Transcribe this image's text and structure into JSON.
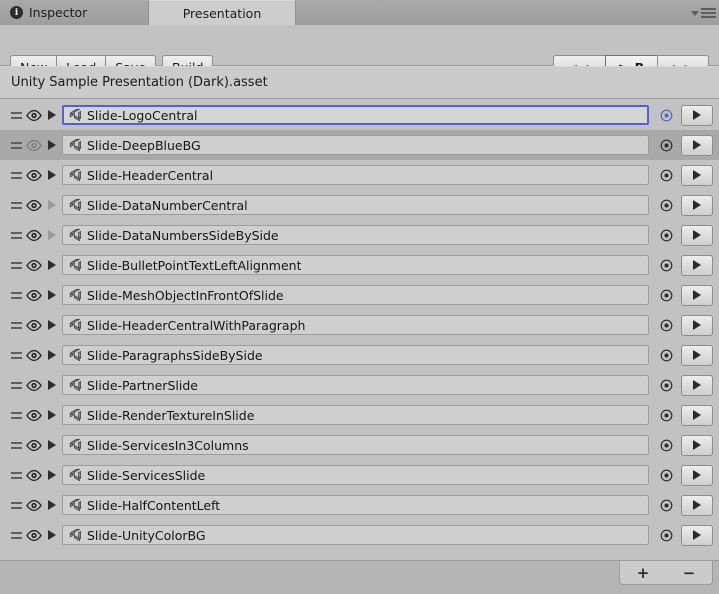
{
  "window": {
    "tabs": [
      {
        "label": "Inspector",
        "icon": "info-icon",
        "active": false
      },
      {
        "label": "Presentation",
        "icon": "",
        "active": true
      }
    ],
    "menu_icon": "hamburger-menu-icon"
  },
  "toolbar": {
    "new_label": "New",
    "load_label": "Load",
    "save_label": "Save",
    "build_label": "Build",
    "nav_prev_label": "<<",
    "nav_current_label": "> B",
    "nav_next_label": ">>"
  },
  "asset": {
    "name": "Unity Sample Presentation (Dark).asset"
  },
  "footer": {
    "add_label": "+",
    "remove_label": "−"
  },
  "colors": {
    "selection_outline": "#4f63d2",
    "panel_bg": "#c2c2c2",
    "row_alt_bg": "#a9a9a9",
    "field_bg": "#cfcfcf"
  },
  "slides": [
    {
      "name": "Slide-LogoCentral",
      "selected": true,
      "visible": true,
      "expandable": true
    },
    {
      "name": "Slide-DeepBlueBG",
      "selected": false,
      "visible": false,
      "expandable": true
    },
    {
      "name": "Slide-HeaderCentral",
      "selected": false,
      "visible": true,
      "expandable": true
    },
    {
      "name": "Slide-DataNumberCentral",
      "selected": false,
      "visible": true,
      "expandable": false
    },
    {
      "name": "Slide-DataNumbersSideBySide",
      "selected": false,
      "visible": true,
      "expandable": false
    },
    {
      "name": "Slide-BulletPointTextLeftAlignment",
      "selected": false,
      "visible": true,
      "expandable": true
    },
    {
      "name": "Slide-MeshObjectInFrontOfSlide",
      "selected": false,
      "visible": true,
      "expandable": true
    },
    {
      "name": "Slide-HeaderCentralWithParagraph",
      "selected": false,
      "visible": true,
      "expandable": true
    },
    {
      "name": "Slide-ParagraphsSideBySide",
      "selected": false,
      "visible": true,
      "expandable": true
    },
    {
      "name": "Slide-PartnerSlide",
      "selected": false,
      "visible": true,
      "expandable": true
    },
    {
      "name": "Slide-RenderTextureInSlide",
      "selected": false,
      "visible": true,
      "expandable": true
    },
    {
      "name": "Slide-ServicesIn3Columns",
      "selected": false,
      "visible": true,
      "expandable": true
    },
    {
      "name": "Slide-ServicesSlide",
      "selected": false,
      "visible": true,
      "expandable": true
    },
    {
      "name": "Slide-HalfContentLeft",
      "selected": false,
      "visible": true,
      "expandable": true
    },
    {
      "name": "Slide-UnityColorBG",
      "selected": false,
      "visible": true,
      "expandable": true
    }
  ]
}
